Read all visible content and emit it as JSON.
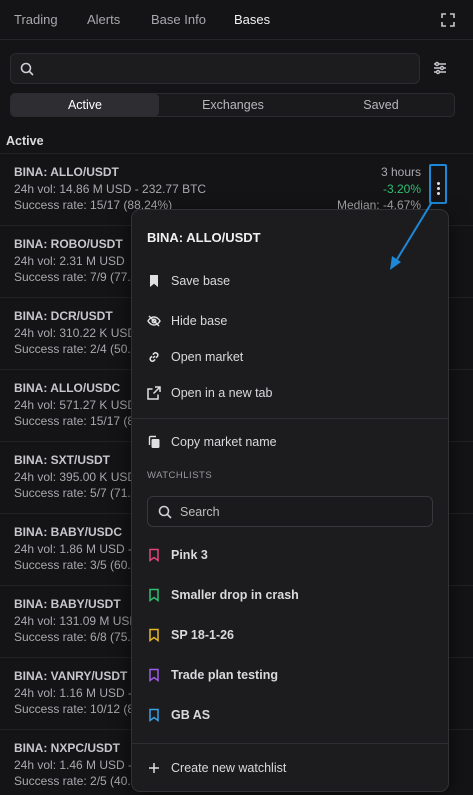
{
  "header": {
    "tabs": [
      {
        "label": "Trading"
      },
      {
        "label": "Alerts"
      },
      {
        "label": "Base Info"
      },
      {
        "label": "Bases"
      }
    ]
  },
  "filters": {
    "search_placeholder": "",
    "segments": [
      {
        "label": "Active"
      },
      {
        "label": "Exchanges"
      },
      {
        "label": "Saved"
      }
    ]
  },
  "section": {
    "title": "Active"
  },
  "rows": [
    {
      "pair": "BINA: ALLO/USDT",
      "vol": "24h vol: 14.86 M USD - 232.77 BTC",
      "rate": "Success rate: 15/17 (88.24%)",
      "time": "3 hours",
      "change": "-3.20%",
      "median": "Median: -4.67%"
    },
    {
      "pair": "BINA: ROBO/USDT",
      "vol": "24h vol: 2.31 M USD",
      "rate": "Success rate: 7/9 (77."
    },
    {
      "pair": "BINA: DCR/USDT",
      "vol": "24h vol: 310.22 K USD",
      "rate": "Success rate: 2/4 (50."
    },
    {
      "pair": "BINA: ALLO/USDC",
      "vol": "24h vol: 571.27 K USD",
      "rate": "Success rate: 15/17 (8"
    },
    {
      "pair": "BINA: SXT/USDT",
      "vol": "24h vol: 395.00 K USD",
      "rate": "Success rate: 5/7 (71."
    },
    {
      "pair": "BINA: BABY/USDC",
      "vol": "24h vol: 1.86 M USD -",
      "rate": "Success rate: 3/5 (60."
    },
    {
      "pair": "BINA: BABY/USDT",
      "vol": "24h vol: 131.09 M USD",
      "rate": "Success rate: 6/8 (75."
    },
    {
      "pair": "BINA: VANRY/USDT",
      "vol": "24h vol: 1.16 M USD -",
      "rate": "Success rate: 10/12 (8"
    },
    {
      "pair": "BINA: NXPC/USDT",
      "vol": "24h vol: 1.46 M USD -",
      "rate": "Success rate: 2/5 (40."
    }
  ],
  "menu": {
    "title": "BINA: ALLO/USDT",
    "save": "Save base",
    "hide": "Hide base",
    "open_market": "Open market",
    "open_tab": "Open in a new tab",
    "copy": "Copy market name",
    "watchlists_heading": "WATCHLISTS",
    "search_placeholder": "Search",
    "watchlists": [
      {
        "label": "Pink 3",
        "color": "#e0457b"
      },
      {
        "label": "Smaller drop in crash",
        "color": "#2fbf71"
      },
      {
        "label": "SP 18-1-26",
        "color": "#e8b62a"
      },
      {
        "label": "Trade plan testing",
        "color": "#9b5de5"
      },
      {
        "label": "GB AS",
        "color": "#3aa0e8"
      }
    ],
    "create": "Create new watchlist"
  },
  "colors": {
    "accent": "#1e88d8",
    "positive": "#2fbf71"
  }
}
